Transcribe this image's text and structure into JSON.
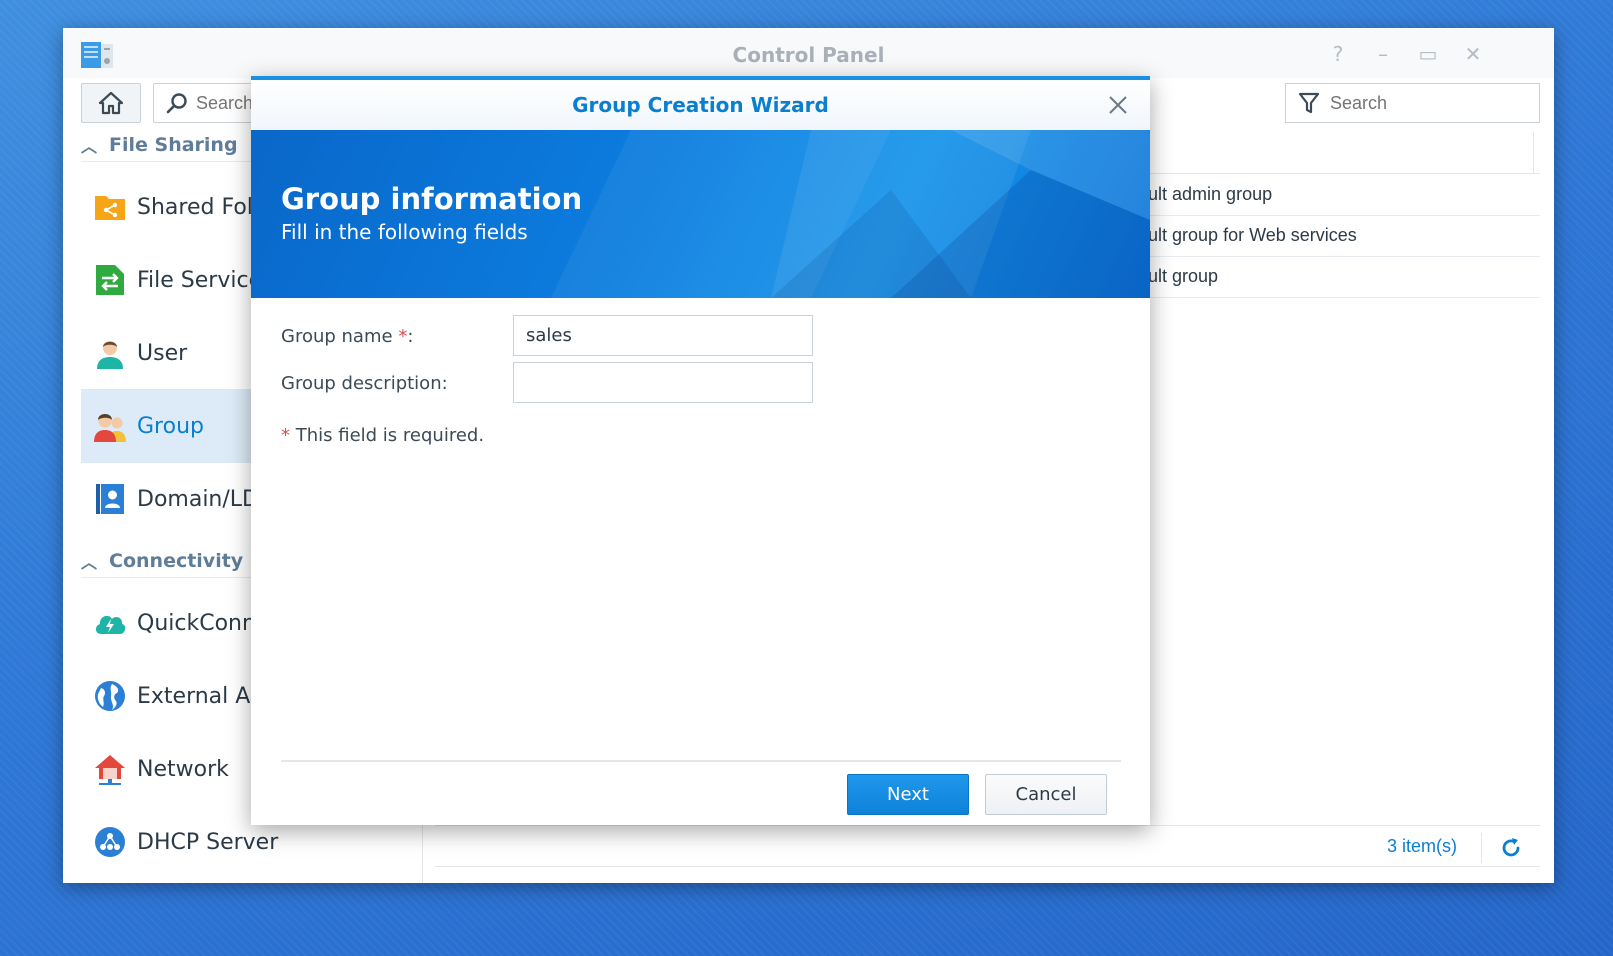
{
  "window": {
    "title": "Control Panel",
    "controls": [
      "help-icon",
      "minimize-icon",
      "maximize-icon",
      "close-icon"
    ]
  },
  "left_search": {
    "placeholder": "Search"
  },
  "right_search": {
    "placeholder": "Search"
  },
  "sidebar": {
    "sections": [
      {
        "label": "File Sharing"
      },
      {
        "label": "Connectivity"
      }
    ],
    "items": [
      {
        "label": "Shared Folder",
        "icon": "shared-folder-icon"
      },
      {
        "label": "File Services",
        "icon": "file-services-icon"
      },
      {
        "label": "User",
        "icon": "user-icon"
      },
      {
        "label": "Group",
        "icon": "group-icon",
        "active": true
      },
      {
        "label": "Domain/LDAP",
        "icon": "domain-ldap-icon"
      },
      {
        "label": "QuickConnect",
        "icon": "quickconnect-icon"
      },
      {
        "label": "External Access",
        "icon": "external-access-icon"
      },
      {
        "label": "Network",
        "icon": "network-icon"
      },
      {
        "label": "DHCP Server",
        "icon": "dhcp-server-icon"
      }
    ]
  },
  "table": {
    "header_visible": "on",
    "rows": [
      "efault admin group",
      "efault group for Web services",
      "efault group"
    ]
  },
  "footer": {
    "count": "3 item(s)"
  },
  "dialog": {
    "title": "Group Creation Wizard",
    "banner_title": "Group information",
    "banner_subtitle": "Fill in the following fields",
    "fields": {
      "name_label": "Group name",
      "name_req": "*",
      "name_colon": ":",
      "name_value": "sales",
      "desc_label": "Group description:",
      "desc_value": ""
    },
    "required_note_star": "*",
    "required_note": "This field is required.",
    "next_label": "Next",
    "cancel_label": "Cancel"
  },
  "colors": {
    "accent": "#0a7fcf",
    "required": "#e34a4a",
    "desktop": "#2f78d6"
  }
}
